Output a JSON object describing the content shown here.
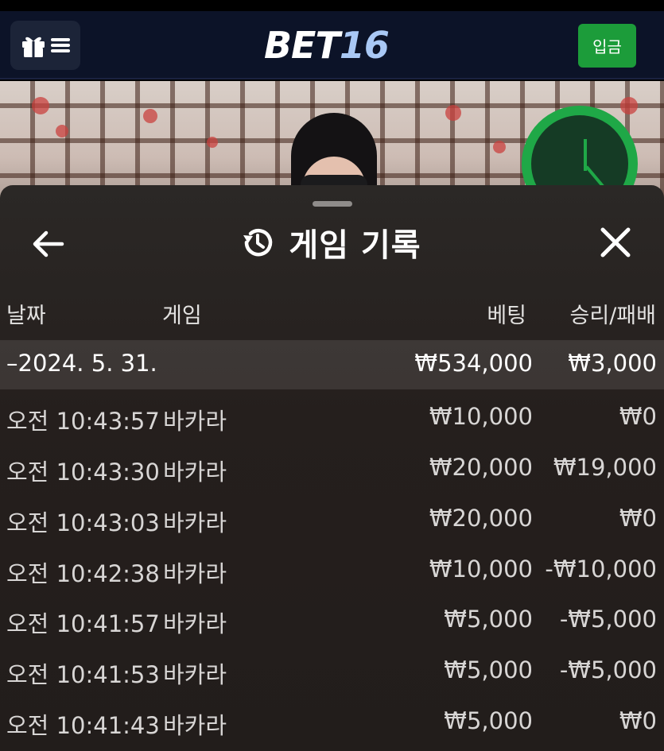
{
  "header": {
    "logo_part1": "BET",
    "logo_part2": "16",
    "deposit_label": "입금"
  },
  "sheet": {
    "title": "게임 기록",
    "columns": {
      "date": "날짜",
      "game": "게임",
      "bet": "베팅",
      "win_loss": "승리/패배"
    },
    "summary": {
      "date": "–2024. 5. 31.",
      "bet": "₩534,000",
      "win_loss": "₩3,000"
    },
    "rows": [
      {
        "time": "오전 10:43:57",
        "game": "바카라",
        "bet": "₩10,000",
        "win_loss": "₩0"
      },
      {
        "time": "오전 10:43:30",
        "game": "바카라",
        "bet": "₩20,000",
        "win_loss": "₩19,000"
      },
      {
        "time": "오전 10:43:03",
        "game": "바카라",
        "bet": "₩20,000",
        "win_loss": "₩0"
      },
      {
        "time": "오전 10:42:38",
        "game": "바카라",
        "bet": "₩10,000",
        "win_loss": "-₩10,000"
      },
      {
        "time": "오전 10:41:57",
        "game": "바카라",
        "bet": "₩5,000",
        "win_loss": "-₩5,000"
      },
      {
        "time": "오전 10:41:53",
        "game": "바카라",
        "bet": "₩5,000",
        "win_loss": "-₩5,000"
      },
      {
        "time": "오전 10:41:43",
        "game": "바카라",
        "bet": "₩5,000",
        "win_loss": "₩0"
      }
    ]
  },
  "icons": {
    "menu": "gift-menu-icon",
    "back": "arrow-left-icon",
    "history": "history-icon",
    "close": "close-icon"
  },
  "colors": {
    "header_bg": "#0c1328",
    "deposit_green": "#1c9c3a",
    "logo_accent": "#a9c8f5",
    "sheet_bg": "#2b2826"
  }
}
